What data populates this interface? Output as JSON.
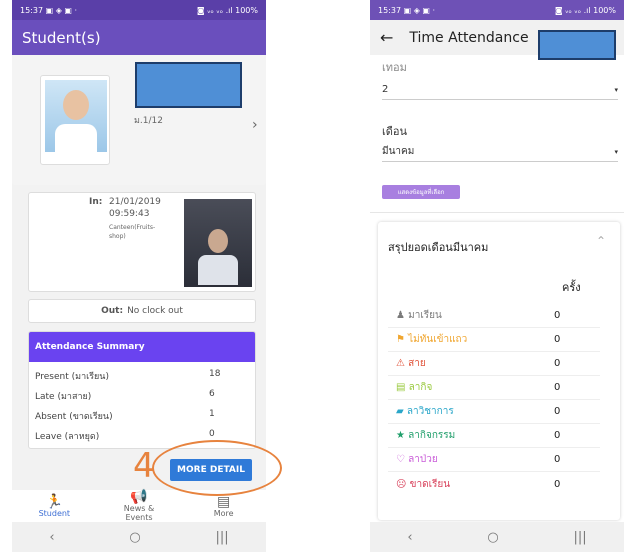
{
  "left": {
    "status_time": "15:37",
    "status_icons": "▣ ◈ ▣  ·",
    "status_right": "◙ ᵥₒ ᵥₒ .ıl 100%",
    "title": "Student(s)",
    "class": "ม.1/12",
    "in_label": "In:",
    "in_date": "21/01/2019",
    "in_time": "09:59:43",
    "in_place": "Canteen(Fruits-shop)",
    "out_label": "Out:",
    "out_value": "No clock out",
    "summary_title": "Attendance Summary",
    "summary": [
      {
        "label": "Present (มาเรียน)",
        "value": "18"
      },
      {
        "label": "Late (มาสาย)",
        "value": "6"
      },
      {
        "label": "Absent (ขาดเรียน)",
        "value": "1"
      },
      {
        "label": "Leave (ลาหยุด)",
        "value": "0"
      }
    ],
    "step_number": "4",
    "more_detail": "MORE DETAIL",
    "tabs": [
      {
        "label": "Student"
      },
      {
        "label": "News & Events"
      },
      {
        "label": "More"
      }
    ]
  },
  "right": {
    "status_time": "15:37",
    "status_icons": "▣ ◈ ▣  ·",
    "status_right": "◙ ᵥₒ ᵥₒ .ıl 100%",
    "title": "Time Attendance",
    "term_label": "เทอม",
    "term_value": "2",
    "month_label": "เดือน",
    "month_value": "มีนาคม",
    "show_button": "แสดงข้อมูลที่เลือก",
    "summary_title": "สรุปยอดเดือนมีนาคม",
    "count_header": "ครั้ง",
    "rows": [
      {
        "icon": "♟",
        "label": "มาเรียน",
        "value": "0",
        "color": "#7b7b7b"
      },
      {
        "icon": "⚑",
        "label": "ไม่ทันเข้าแถว",
        "value": "0",
        "color": "#f0a630"
      },
      {
        "icon": "⚠",
        "label": "สาย",
        "value": "0",
        "color": "#e0533a"
      },
      {
        "icon": "▤",
        "label": "ลากิจ",
        "value": "0",
        "color": "#98c93c"
      },
      {
        "icon": "▰",
        "label": "ลาวิชาการ",
        "value": "0",
        "color": "#2aa6c9"
      },
      {
        "icon": "★",
        "label": "ลากิจกรรม",
        "value": "0",
        "color": "#1f9e6a"
      },
      {
        "icon": "♡",
        "label": "ลาป่วย",
        "value": "0",
        "color": "#c95cd8"
      },
      {
        "icon": "☹",
        "label": "ขาดเรียน",
        "value": "0",
        "color": "#d8405a"
      }
    ]
  }
}
